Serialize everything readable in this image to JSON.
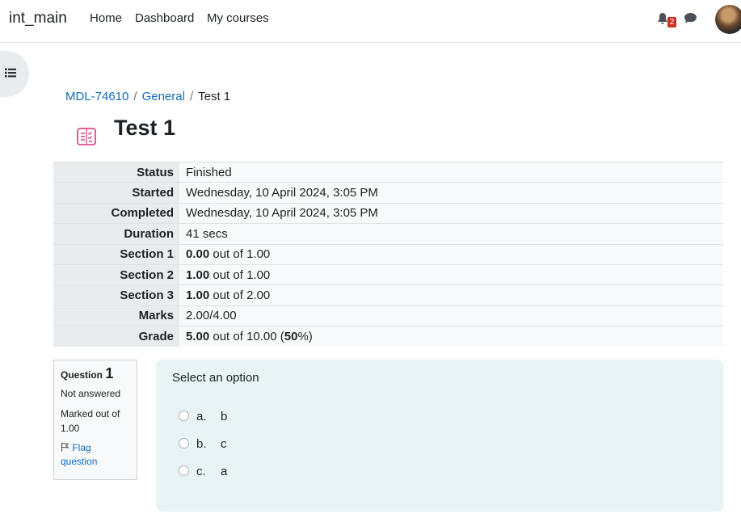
{
  "header": {
    "site_name": "int_main",
    "nav": [
      "Home",
      "Dashboard",
      "My courses"
    ],
    "notification_count": "2",
    "icons": {
      "notifications": "bell-icon",
      "messages": "chat-icon",
      "drawer": "list-icon",
      "quiz": "quiz-icon"
    },
    "accent_color": "#0f6cbf",
    "badge_color": "#ca3120"
  },
  "breadcrumb": [
    "MDL-74610",
    "General",
    "Test 1"
  ],
  "page_title": "Test 1",
  "summary": {
    "rows": [
      {
        "label": "Status",
        "value": "Finished"
      },
      {
        "label": "Started",
        "value": "Wednesday, 10 April 2024, 3:05 PM"
      },
      {
        "label": "Completed",
        "value": "Wednesday, 10 April 2024, 3:05 PM"
      },
      {
        "label": "Duration",
        "value": "41 secs"
      },
      {
        "label": "Section 1",
        "bold": "0.00",
        "rest": " out of 1.00"
      },
      {
        "label": "Section 2",
        "bold": "1.00",
        "rest": " out of 1.00"
      },
      {
        "label": "Section 3",
        "bold": "1.00",
        "rest": " out of 2.00"
      },
      {
        "label": "Marks",
        "value": "2.00/4.00"
      },
      {
        "label": "Grade",
        "bold": "5.00",
        "rest": " out of 10.00 (",
        "bold2": "50",
        "rest2": "%)"
      }
    ]
  },
  "question": {
    "label": "Question",
    "number": "1",
    "state": "Not answered",
    "marked": "Marked out of 1.00",
    "flag_label": "Flag question",
    "text": "Select an option",
    "options": [
      {
        "letter": "a.",
        "text": "b"
      },
      {
        "letter": "b.",
        "text": "c"
      },
      {
        "letter": "c.",
        "text": "a"
      }
    ]
  }
}
